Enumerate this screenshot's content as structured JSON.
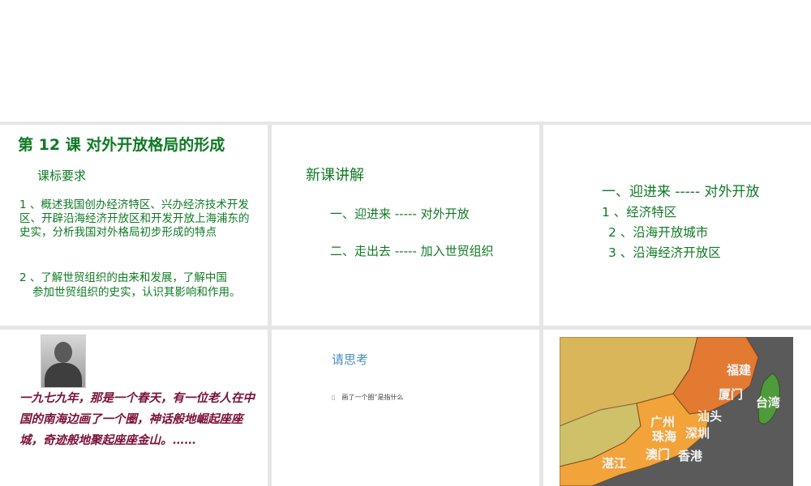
{
  "slide1": {
    "title": "第 12 课  对外开放格局的形成",
    "subtitle": "课标要求",
    "point1": "1 、概述我国创办经济特区、兴办经济技术开发区、开辟沿海经济开放区和开发开放上海浦东的史实，分析我国对外格局初步形成的特点",
    "point2_line1": "2 、了解世贸组织的由来和发展，了解中国",
    "point2_line2": "参加世贸组织的史实，认识其影响和作用。"
  },
  "slide2": {
    "title": "新课讲解",
    "item1": "一、迎进来 ----- 对外开放",
    "item2": "二、走出去 ----- 加入世贸组织"
  },
  "slide3": {
    "heading": "一、迎进来 ----- 对外开放",
    "item1": "1 、经济特区",
    "item2": "2 、沿海开放城市",
    "item3": "3 、沿海经济开放区"
  },
  "slide4": {
    "story": "一九七九年，那是一个春天，有一位老人在中国的南海边画了一个圈，神话般地崛起座座城，奇迹般地聚起座座金山。……"
  },
  "slide5": {
    "heading": "请思考",
    "question": "画了一个圈”是指什么"
  },
  "slide6": {
    "map_labels": {
      "fujian": "福建",
      "xiamen": "厦门",
      "taiwan": "台湾",
      "guangzhou": "广州",
      "shantou": "汕头",
      "zhuhai": "珠海",
      "shenzhen": "深圳",
      "macau": "澳门",
      "hongkong": "香港",
      "zhanjiang": "湛江"
    }
  },
  "colors": {
    "green_text": "#0f7a24",
    "story_text": "#7a1038",
    "think_blue": "#4a8fbf"
  }
}
